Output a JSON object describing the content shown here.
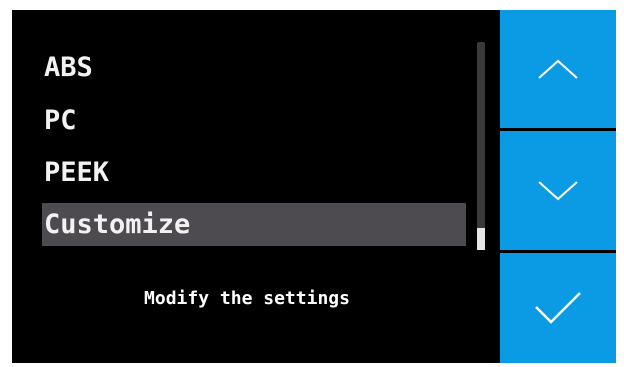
{
  "menu": {
    "items": [
      {
        "label": "ABS",
        "selected": false
      },
      {
        "label": "PC",
        "selected": false
      },
      {
        "label": "PEEK",
        "selected": false
      },
      {
        "label": "Customize",
        "selected": true
      }
    ]
  },
  "hint_text": "Modify the settings",
  "buttons": {
    "up_icon": "chevron-up-icon",
    "down_icon": "chevron-down-icon",
    "confirm_icon": "checkmark-icon"
  },
  "colors": {
    "background": "#000000",
    "button": "#0b9be5",
    "selected_row": "#4d4b50",
    "text": "#f2f2f2"
  }
}
